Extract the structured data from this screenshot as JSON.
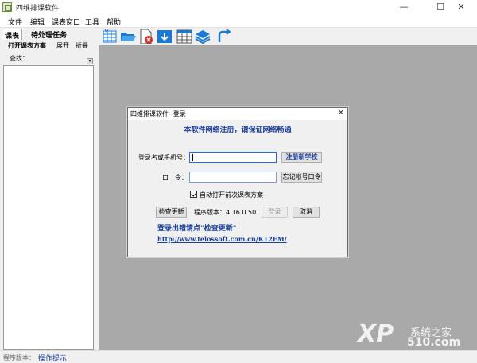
{
  "window": {
    "title": "四维排课软件",
    "controls": {
      "minimize": "—",
      "maximize": "☐",
      "close": "✕"
    }
  },
  "menu": [
    "文件",
    "编辑",
    "课表窗口",
    "工具",
    "帮助"
  ],
  "left_panel": {
    "tabs": [
      "课表",
      "待处理任务"
    ],
    "buttons": {
      "open_plan": "打开课表方案",
      "expand": "展开",
      "fold": "折叠"
    },
    "search_label": "查找："
  },
  "toolbar_icons": [
    "schedule-grid-icon",
    "open-folder-icon",
    "delete-file-icon",
    "download-icon",
    "table-icon",
    "layers-icon",
    "refresh-arrow-icon"
  ],
  "status_bar": {
    "version_label": "程序版本：",
    "hint": "操作提示"
  },
  "watermark": {
    "brand": "XP",
    "name": "系统之家",
    "site": "510.com"
  },
  "login_dialog": {
    "title": "四维排课软件--登录",
    "close": "✕",
    "notice": "本软件网络注册，请保证网络畅通",
    "username_label": "登录名或手机号：",
    "username_value": "",
    "password_label": "口　令：",
    "password_value": "",
    "register_button": "注册新学校",
    "forgot_button": "忘记帐号口令",
    "auto_open_label": "自动打开前次课表方案",
    "auto_open_checked": true,
    "check_update_button": "检查更新",
    "version_text": "程序版本：4.16.0.50",
    "login_button": "登录",
    "cancel_button": "取消",
    "error_hint": "登录出错请点\"检查更新\"",
    "link": "http://www.telossoft.com.cn/K12EM/"
  },
  "colors": {
    "accent_blue": "#1a3fa0",
    "workspace_gray": "#a9a9a9",
    "icon_blue": "#1a7ad4"
  }
}
